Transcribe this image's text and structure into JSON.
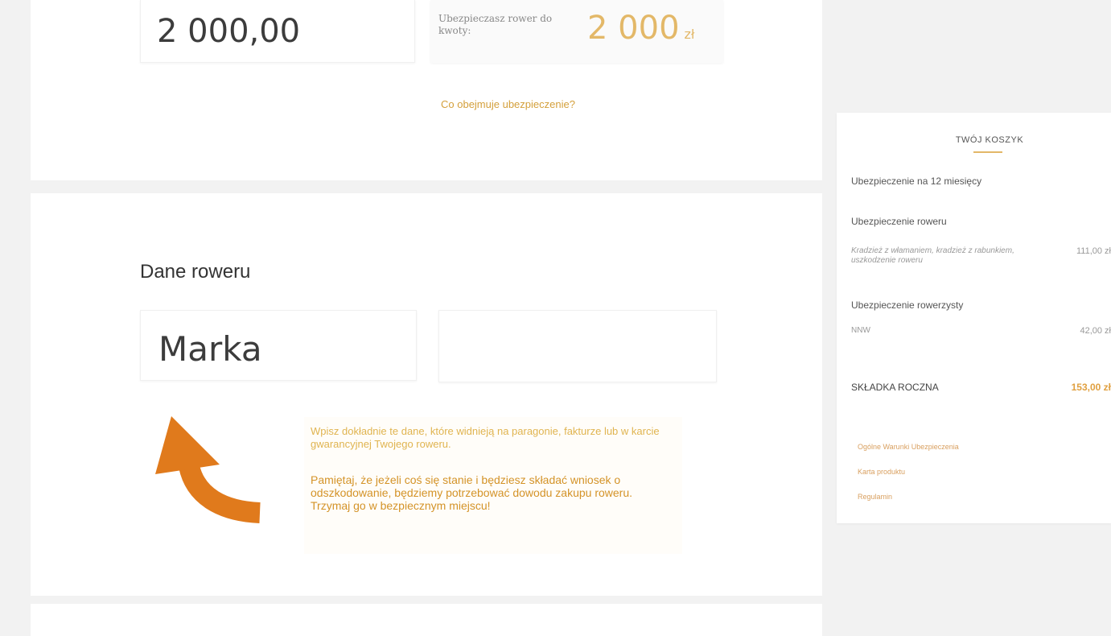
{
  "calculator": {
    "amount_value": "2 000,00",
    "insure_label": "Ubezpieczasz rower do kwoty:",
    "insure_value": "2 000",
    "insure_currency": "zł",
    "coverage_link": "Co obejmuje ubezpieczenie?"
  },
  "bike_form": {
    "heading": "Dane roweru",
    "brand_placeholder": "Marka",
    "model_placeholder": "",
    "tip_text_1": "Wpisz dokładnie te dane, które widnieją na paragonie, fakturze lub w karcie gwarancyjnej Twojego roweru.",
    "tip_text_2": "Pamiętaj, że jeżeli coś się stanie i będziesz składać wniosek o odszkodowanie, będziemy potrzebować dowodu zakupu roweru. Trzymaj go w bezpiecznym miejscu!"
  },
  "cart": {
    "title": "TWÓJ KOSZYK",
    "period": "Ubezpieczenie na 12 miesięcy",
    "bike_section": "Ubezpieczenie roweru",
    "bike_item": "Kradzież z włamaniem, kradzież z rabunkiem, uszkodzenie roweru",
    "bike_price": "111,00 zł",
    "rider_section": "Ubezpieczenie rowerzysty",
    "rider_item": "NNW",
    "rider_price": "42,00 zł",
    "total_label": "SKŁADKA ROCZNA",
    "total_value": "153,00 zł",
    "documents": [
      "Ogólne Warunki Ubezpieczenia",
      "Karta produktu",
      "Regulamin"
    ]
  },
  "colors": {
    "accent": "#e3b868",
    "arrow": "#e07a1c",
    "tip_text": "#d49328"
  }
}
